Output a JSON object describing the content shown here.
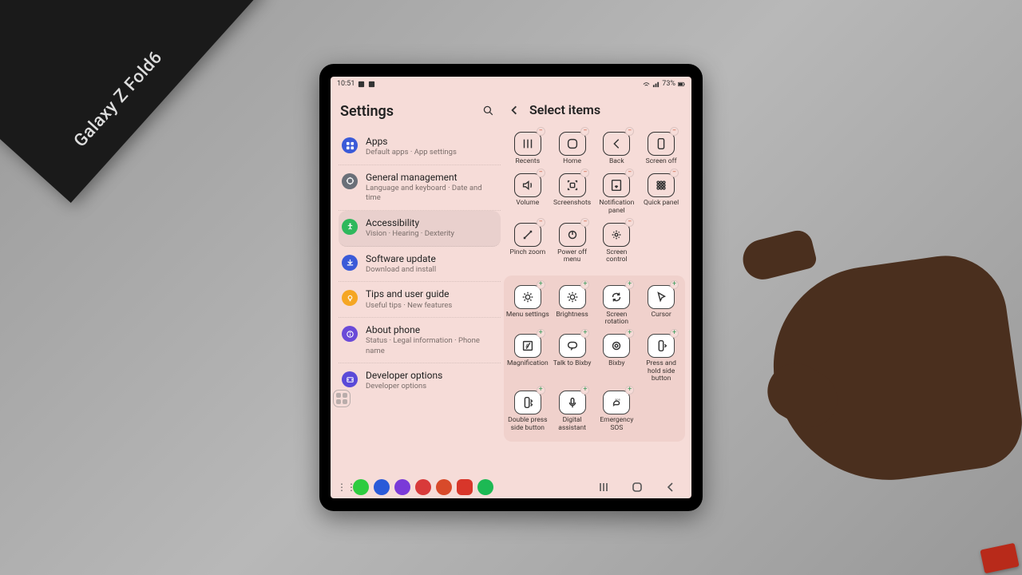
{
  "corner_box_label": "Galaxy Z Fold6",
  "status": {
    "time": "10:51",
    "battery": "73%"
  },
  "left": {
    "title": "Settings",
    "items": [
      {
        "icon": "apps",
        "color": "#3a5ad8",
        "title": "Apps",
        "sub": "Default apps · App settings"
      },
      {
        "icon": "general",
        "color": "#6a6f78",
        "title": "General management",
        "sub": "Language and keyboard · Date and time"
      },
      {
        "icon": "a11y",
        "color": "#2eb85c",
        "title": "Accessibility",
        "sub": "Vision · Hearing · Dexterity",
        "active": true
      },
      {
        "icon": "update",
        "color": "#3a5ad8",
        "title": "Software update",
        "sub": "Download and install"
      },
      {
        "icon": "tips",
        "color": "#f5a623",
        "title": "Tips and user guide",
        "sub": "Useful tips · New features"
      },
      {
        "icon": "about",
        "color": "#6a4ad8",
        "title": "About phone",
        "sub": "Status · Legal information · Phone name"
      },
      {
        "icon": "dev",
        "color": "#5a4ad8",
        "title": "Developer options",
        "sub": "Developer options"
      }
    ]
  },
  "right": {
    "title": "Select items",
    "top": [
      {
        "key": "recents",
        "label": "Recents"
      },
      {
        "key": "home",
        "label": "Home"
      },
      {
        "key": "back",
        "label": "Back"
      },
      {
        "key": "screenoff",
        "label": "Screen off"
      },
      {
        "key": "volume",
        "label": "Volume"
      },
      {
        "key": "screenshots",
        "label": "Screenshots"
      },
      {
        "key": "notif",
        "label": "Notification panel"
      },
      {
        "key": "quick",
        "label": "Quick panel"
      },
      {
        "key": "pinch",
        "label": "Pinch zoom"
      },
      {
        "key": "power",
        "label": "Power off menu"
      },
      {
        "key": "screenctrl",
        "label": "Screen control"
      }
    ],
    "bottom": [
      {
        "key": "menusettings",
        "label": "Menu settings"
      },
      {
        "key": "brightness",
        "label": "Brightness"
      },
      {
        "key": "rotation",
        "label": "Screen rotation"
      },
      {
        "key": "cursor",
        "label": "Cursor"
      },
      {
        "key": "magnify",
        "label": "Magnification"
      },
      {
        "key": "talkbixby",
        "label": "Talk to Bixby"
      },
      {
        "key": "bixby",
        "label": "Bixby"
      },
      {
        "key": "presshold",
        "label": "Press and hold side button"
      },
      {
        "key": "doublepress",
        "label": "Double press side button"
      },
      {
        "key": "digital",
        "label": "Digital assistant"
      },
      {
        "key": "sos",
        "label": "Emergency SOS"
      }
    ]
  }
}
